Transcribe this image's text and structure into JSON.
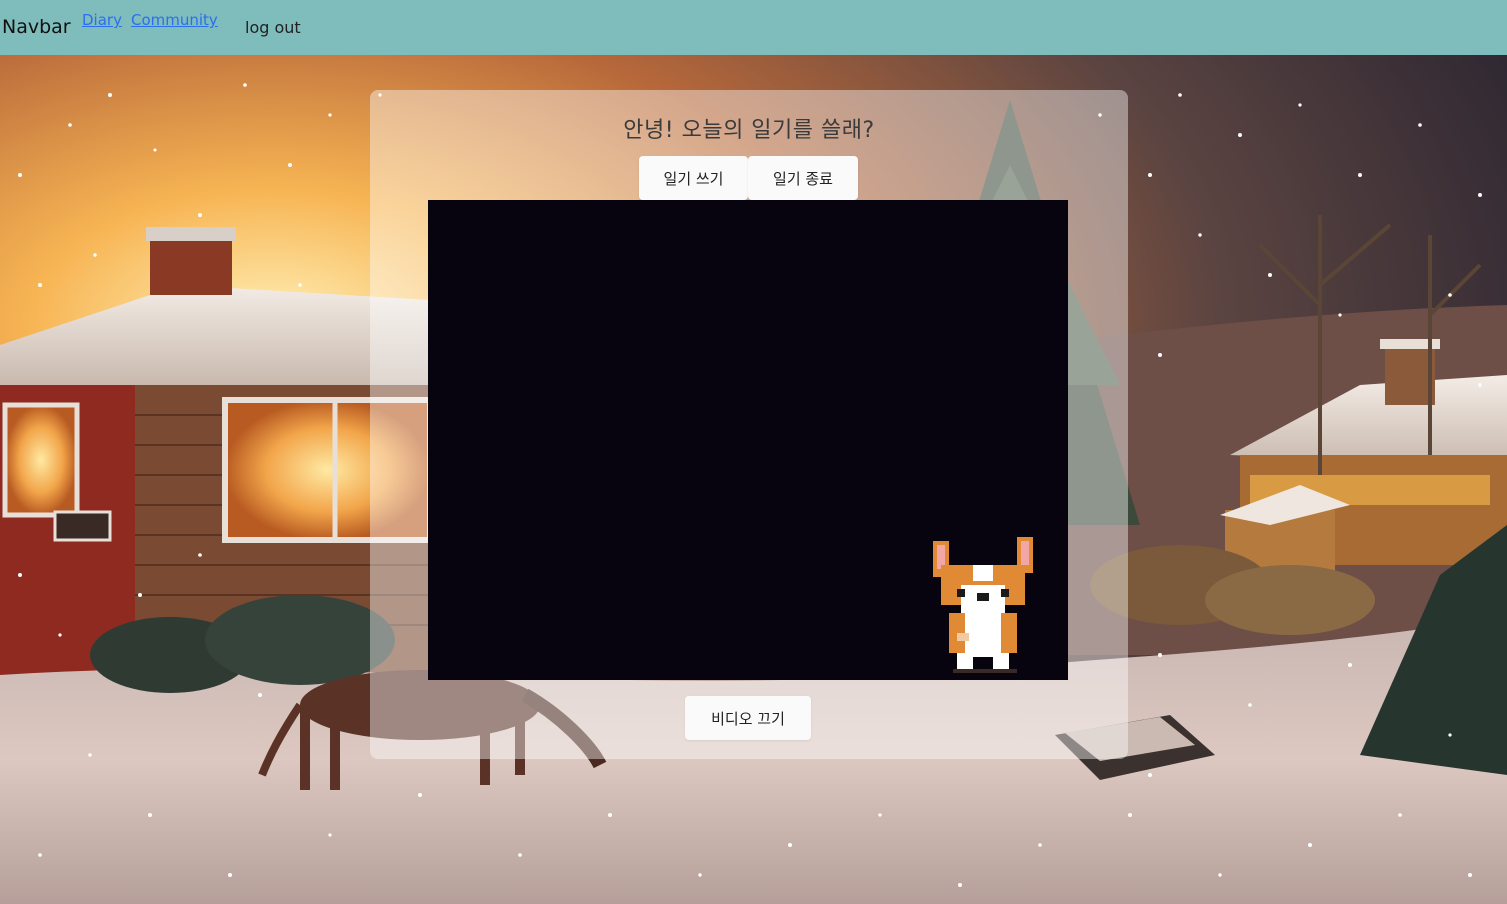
{
  "navbar": {
    "brand": "Navbar",
    "links": [
      {
        "label": "Diary"
      },
      {
        "label": "Community"
      }
    ],
    "logout_label": "log out"
  },
  "panel": {
    "title": "안녕! 오늘의 일기를 쓸래?",
    "write_button": "일기 쓰기",
    "end_button": "일기 종료",
    "video_off_button": "비디오 끄기"
  },
  "icons": {
    "background": "snowy-winter-village-illustration",
    "mascot": "corgi-pixel-icon"
  },
  "colors": {
    "navbar": "#7fbcbc",
    "link": "#2a6ff0",
    "video_bg": "#07030f"
  }
}
